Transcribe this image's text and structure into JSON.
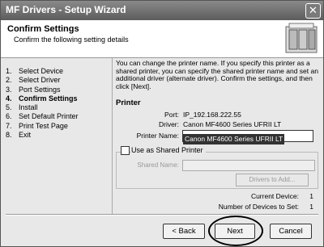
{
  "window": {
    "title": "MF Drivers - Setup Wizard"
  },
  "header": {
    "title": "Confirm Settings",
    "subtitle": "Confirm the following setting details"
  },
  "steps": [
    {
      "num": "1.",
      "label": "Select Device"
    },
    {
      "num": "2.",
      "label": "Select Driver"
    },
    {
      "num": "3.",
      "label": "Port Settings"
    },
    {
      "num": "4.",
      "label": "Confirm Settings",
      "active": true
    },
    {
      "num": "5.",
      "label": "Install"
    },
    {
      "num": "6.",
      "label": "Set Default Printer"
    },
    {
      "num": "7.",
      "label": "Print Test Page"
    },
    {
      "num": "8.",
      "label": "Exit"
    }
  ],
  "content": {
    "intro": "You can change the printer name. If you specify this printer as a shared printer, you can specify the shared printer name and set an additional driver (alternate driver). Confirm the settings, and then click [Next].",
    "printer_section": "Printer",
    "port_label": "Port:",
    "port_value": "IP_192.168.222.55",
    "driver_label": "Driver:",
    "driver_value": "Canon MF4600 Series UFRII LT",
    "printer_name_label": "Printer Name:",
    "printer_name_value": "Canon MF4600 Series UFRII LT",
    "shared_checkbox_label": "Use as Shared Printer",
    "shared_name_label": "Shared Name:",
    "drivers_button": "Drivers to Add...",
    "current_device_label": "Current Device:",
    "current_device_value": "1",
    "devices_to_set_label": "Number of Devices to Set:",
    "devices_to_set_value": "1"
  },
  "buttons": {
    "back": "< Back",
    "next": "Next",
    "cancel": "Cancel"
  }
}
